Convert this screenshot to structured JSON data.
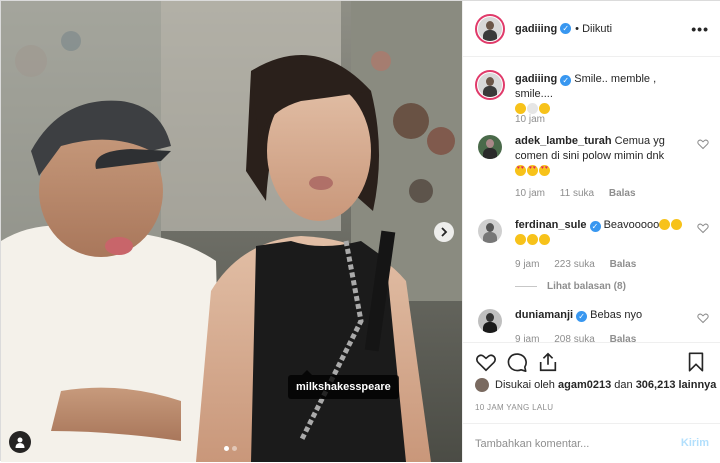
{
  "post": {
    "author": "gadiiing",
    "follow_status": "• Diikuti",
    "more_label": "•••",
    "tag_label": "milkshakesspeare",
    "colors": {
      "accent": "#3897f0",
      "story_ring": "#e03a6a",
      "send_disabled": "#b2dffc"
    }
  },
  "caption": {
    "username": "gadiiing",
    "text": "Smile.. memble , smile....",
    "emoji": [
      "😝",
      "😐",
      "😊"
    ],
    "time": "10 jam"
  },
  "comments": [
    {
      "username": "adek_lambe_turah",
      "verified": false,
      "text": "Cemua yg comen di sini polow mimin dnk",
      "emoji": [
        "😍",
        "😍",
        "😍"
      ],
      "time": "10 jam",
      "likes": "11 suka",
      "reply": "Balas"
    },
    {
      "username": "ferdinan_sule",
      "verified": true,
      "text": "Beavooooo",
      "emoji": [
        "👍",
        "👏",
        "👏",
        "👏",
        "👏"
      ],
      "time": "9 jam",
      "likes": "223 suka",
      "reply": "Balas",
      "view_replies": "Lihat balasan (8)"
    },
    {
      "username": "duniamanji",
      "verified": true,
      "text": "Bebas nyo",
      "time": "9 jam",
      "likes": "208 suka",
      "reply": "Balas"
    }
  ],
  "likes": {
    "prefix": "Disukai oleh",
    "first_user": "agam0213",
    "joiner": "dan",
    "others": "306,213 lainnya"
  },
  "timestamp": "10 JAM YANG LALU",
  "comment_box": {
    "placeholder": "Tambahkan komentar...",
    "send_label": "Kirim"
  },
  "icons": [
    "heart-icon",
    "comment-icon",
    "share-icon",
    "bookmark-icon",
    "next-arrow-icon",
    "user-tag-icon",
    "verified-icon",
    "more-icon"
  ],
  "carousel": {
    "slides": 2,
    "current": 1
  }
}
